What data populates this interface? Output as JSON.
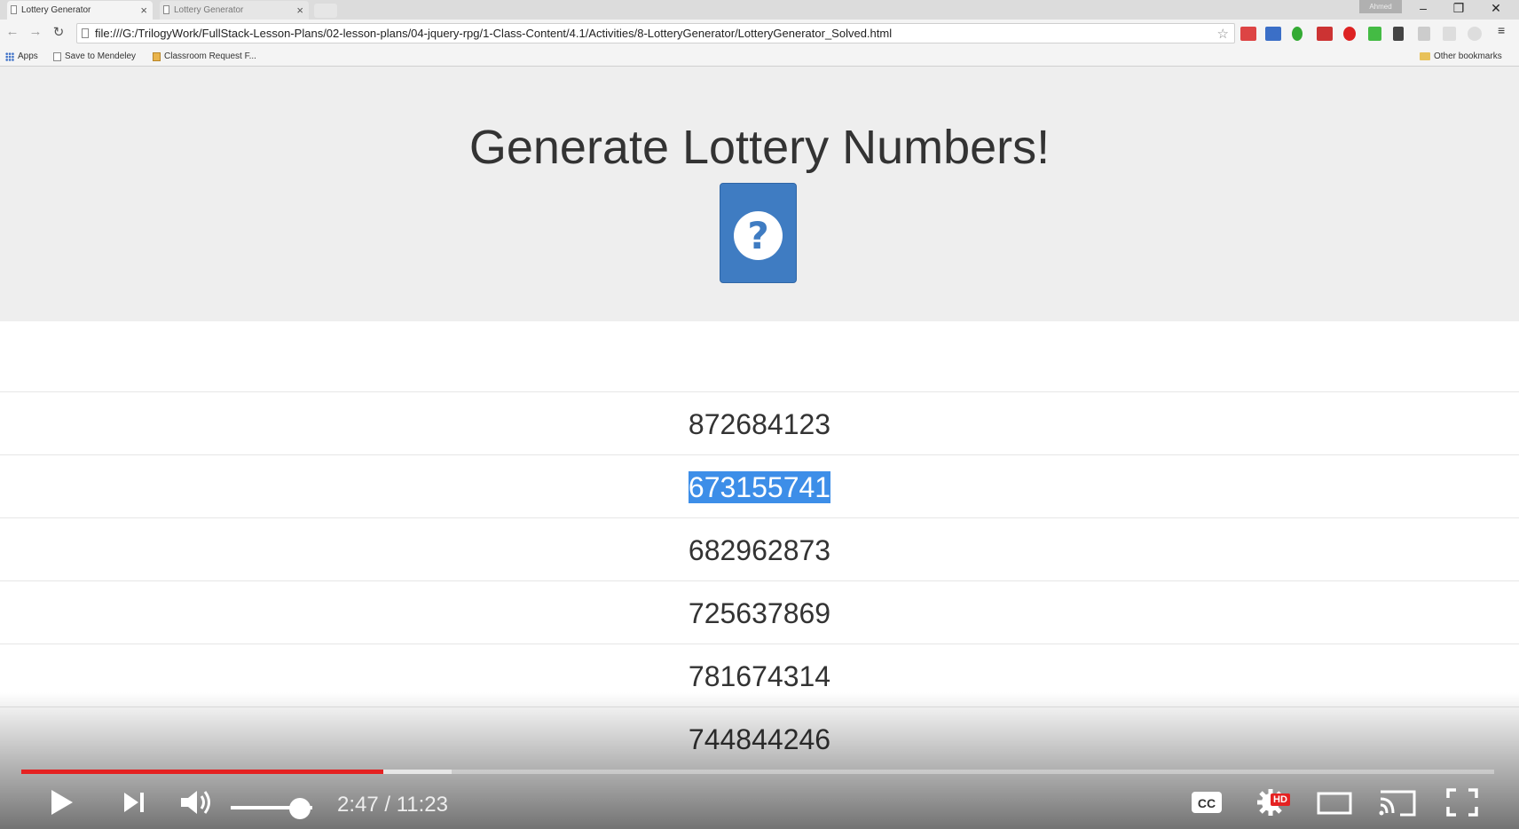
{
  "browser": {
    "tabs": [
      {
        "label": "Lottery Generator"
      },
      {
        "label": "Lottery Generator"
      }
    ],
    "profile_label": "Ahmed",
    "address": "file:///G:/TrilogyWork/FullStack-Lesson-Plans/02-lesson-plans/04-jquery-rpg/1-Class-Content/4.1/Activities/8-LotteryGenerator/LotteryGenerator_Solved.html",
    "bookmarks": [
      {
        "label": "Apps",
        "icon": "apps-grid-icon"
      },
      {
        "label": "Save to Mendeley",
        "icon": "page-icon"
      },
      {
        "label": "Classroom Request F...",
        "icon": "classroom-icon"
      }
    ],
    "other_bookmarks": "Other bookmarks"
  },
  "page": {
    "title": "Generate Lottery Numbers!",
    "button_icon": "question-circle-icon",
    "numbers": [
      "872684123",
      "673155741",
      "682962873",
      "725637869",
      "781674314",
      "744844246"
    ],
    "selected_index": 1
  },
  "player": {
    "current_time": "2:47",
    "duration": "11:23",
    "time_display": "2:47 / 11:23",
    "played_fraction": 0.246,
    "loaded_fraction": 0.292,
    "volume_fraction": 0.85,
    "hd_badge": "HD",
    "accent_color": "#e52222"
  }
}
